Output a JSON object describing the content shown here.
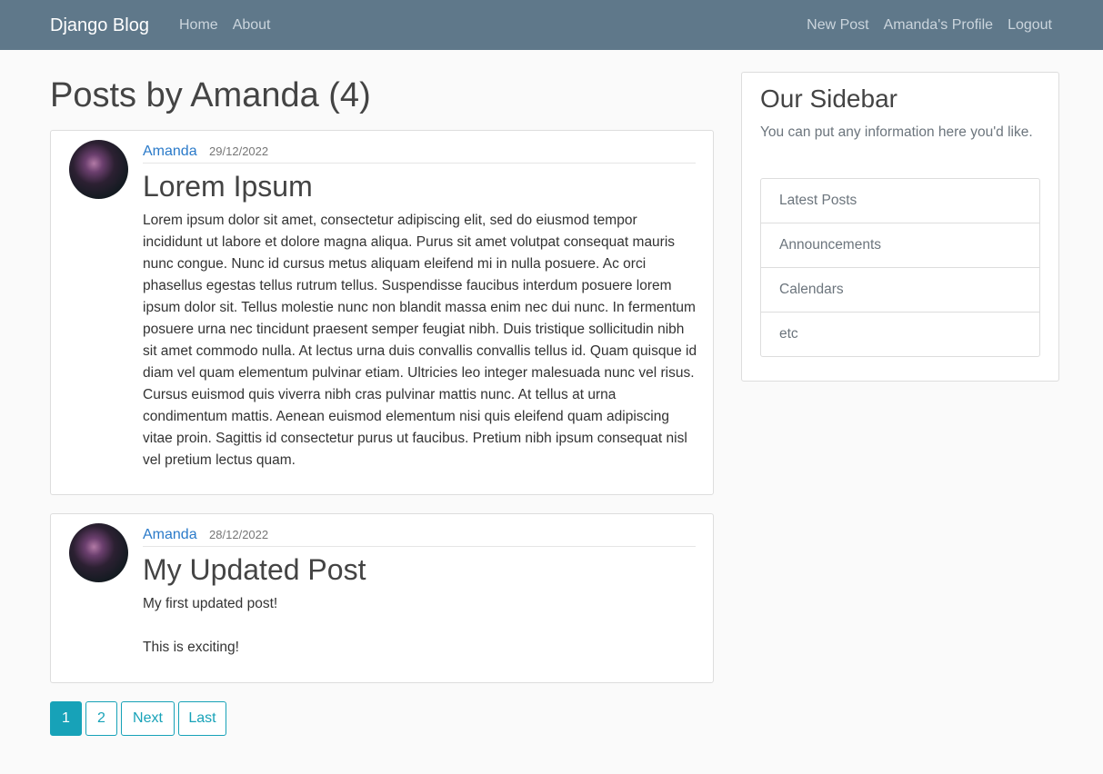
{
  "nav": {
    "brand": "Django Blog",
    "left_links": [
      "Home",
      "About"
    ],
    "right_links": [
      "New Post",
      "Amanda's Profile",
      "Logout"
    ]
  },
  "page_title": "Posts by Amanda (4)",
  "posts": [
    {
      "author": "Amanda",
      "date": "29/12/2022",
      "title": "Lorem Ipsum",
      "body": [
        "Lorem ipsum dolor sit amet, consectetur adipiscing elit, sed do eiusmod tempor incididunt ut labore et dolore magna aliqua. Purus sit amet volutpat consequat mauris nunc congue. Nunc id cursus metus aliquam eleifend mi in nulla posuere. Ac orci phasellus egestas tellus rutrum tellus. Suspendisse faucibus interdum posuere lorem ipsum dolor sit. Tellus molestie nunc non blandit massa enim nec dui nunc. In fermentum posuere urna nec tincidunt praesent semper feugiat nibh. Duis tristique sollicitudin nibh sit amet commodo nulla. At lectus urna duis convallis convallis tellus id. Quam quisque id diam vel quam elementum pulvinar etiam. Ultricies leo integer malesuada nunc vel risus. Cursus euismod quis viverra nibh cras pulvinar mattis nunc. At tellus at urna condimentum mattis. Aenean euismod elementum nisi quis eleifend quam adipiscing vitae proin. Sagittis id consectetur purus ut faucibus. Pretium nibh ipsum consequat nisl vel pretium lectus quam."
      ]
    },
    {
      "author": "Amanda",
      "date": "28/12/2022",
      "title": "My Updated Post",
      "body": [
        "My first updated post!",
        "This is exciting!"
      ]
    }
  ],
  "pagination": {
    "pages": [
      "1",
      "2"
    ],
    "active": "1",
    "next": "Next",
    "last": "Last"
  },
  "sidebar": {
    "title": "Our Sidebar",
    "description": "You can put any information here you'd like.",
    "items": [
      "Latest Posts",
      "Announcements",
      "Calendars",
      "etc"
    ]
  },
  "colors": {
    "navbar": "#5f788a",
    "link": "#2a7ac9",
    "pagination_accent": "#17a2b8"
  }
}
